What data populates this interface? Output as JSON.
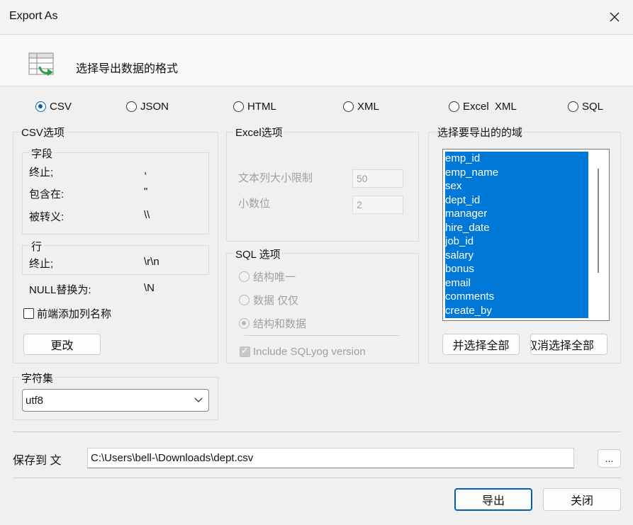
{
  "window": {
    "title": "Export As"
  },
  "header": {
    "text": "选择导出数据的格式",
    "icon": "export-table-icon"
  },
  "formats": [
    {
      "label": "CSV",
      "selected": true
    },
    {
      "label": "JSON",
      "selected": false
    },
    {
      "label": "HTML",
      "selected": false
    },
    {
      "label": "XML",
      "selected": false
    },
    {
      "label": "Excel  XML",
      "selected": false
    },
    {
      "label": "SQL",
      "selected": false
    }
  ],
  "csv": {
    "group_title": "CSV选项",
    "fields_title": "字段",
    "terminated_label": "终止;",
    "terminated_value": ",",
    "enclosed_label": "包含在:",
    "enclosed_value": "\"",
    "escaped_label": "被转义:",
    "escaped_value": "\\\\",
    "lines_title": "行",
    "line_terminated_label": "终止;",
    "line_terminated_value": "\\r\\n",
    "null_label": "NULL替换为:",
    "null_value": "\\N",
    "add_column_names_label": "前端添加列名称",
    "add_column_names_checked": false,
    "change_button": "更改"
  },
  "excel": {
    "group_title": "Excel选项",
    "text_size_label": "文本列大小限制",
    "text_size_value": "50",
    "decimal_label": "小数位",
    "decimal_value": "2"
  },
  "sql": {
    "group_title": "SQL 选项",
    "options": [
      {
        "label": "结构唯一",
        "selected": false
      },
      {
        "label": "数据 仅仅",
        "selected": false
      },
      {
        "label": "结构和数据",
        "selected": true
      }
    ],
    "include_version_label": "Include SQLyog version",
    "include_version_checked": true
  },
  "fields": {
    "group_title": "选择要导出的的域",
    "items": [
      "emp_id",
      "emp_name",
      "sex",
      "dept_id",
      "manager",
      "hire_date",
      "job_id",
      "salary",
      "bonus",
      "email",
      "comments",
      "create_by"
    ],
    "select_all_button": "并选择全部",
    "deselect_all_button": "取消选择全部"
  },
  "charset": {
    "group_title": "字符集",
    "value": "utf8"
  },
  "save": {
    "label": "保存到 文",
    "path": "C:\\Users\\bell-\\Downloads\\dept.csv",
    "browse_button": "..."
  },
  "footer": {
    "export_button": "导出",
    "close_button": "关闭"
  },
  "colors": {
    "accent": "#005fb8",
    "selection": "#0078d7"
  }
}
